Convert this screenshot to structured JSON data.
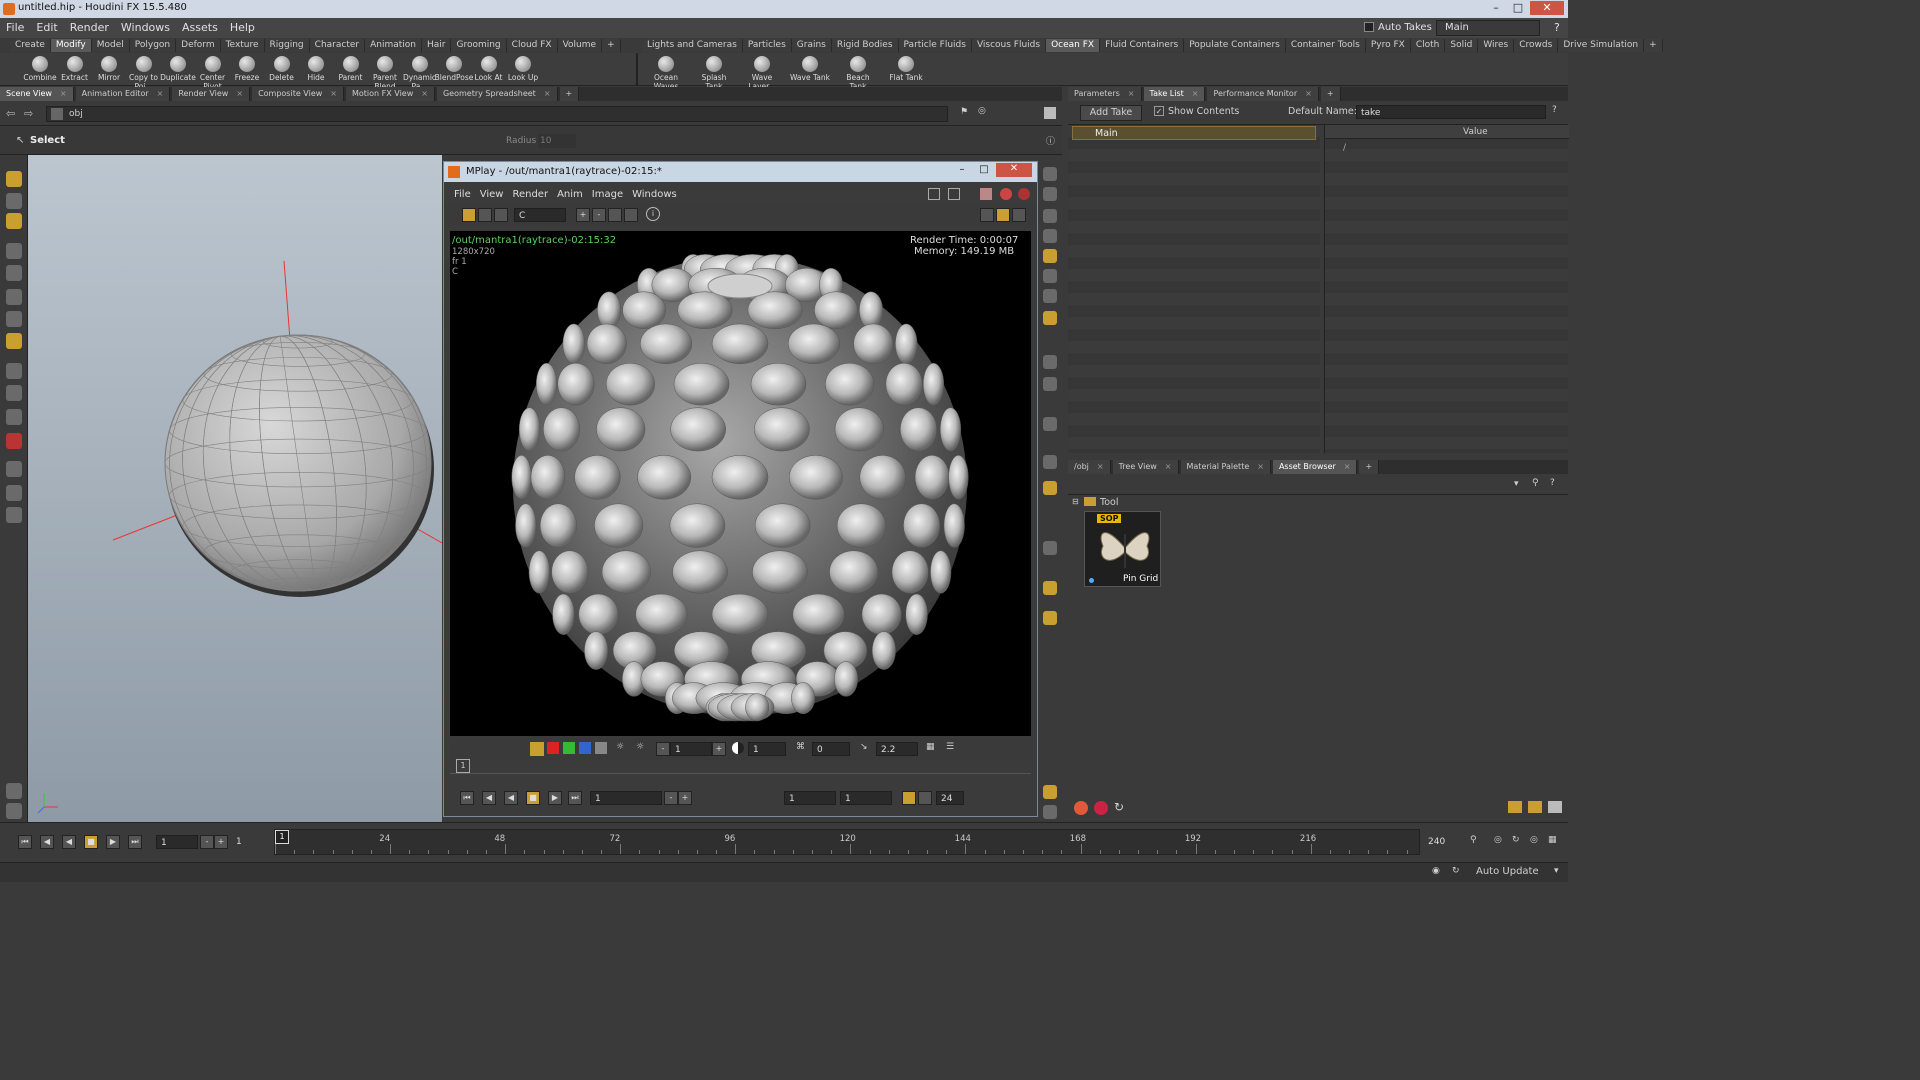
{
  "app": {
    "title": "untitled.hip - Houdini FX 15.5.480",
    "menu": [
      "File",
      "Edit",
      "Render",
      "Windows",
      "Assets",
      "Help"
    ],
    "auto_takes_label": "Auto Takes",
    "desktop": "Main"
  },
  "shelf_left": {
    "tabs": [
      "Create",
      "Modify",
      "Model",
      "Polygon",
      "Deform",
      "Texture",
      "Rigging",
      "Character",
      "Animation",
      "Hair",
      "Grooming",
      "Cloud FX",
      "Volume"
    ],
    "active_tab": "Modify",
    "tools": [
      "Combine",
      "Extract",
      "Mirror",
      "Copy to Poi...",
      "Duplicate",
      "Center Pivot",
      "Freeze",
      "Delete",
      "Hide",
      "Parent",
      "Parent Blend",
      "Dynamic Pa...",
      "BlendPose",
      "Look At",
      "Look Up"
    ]
  },
  "shelf_right": {
    "tabs": [
      "Lights and Cameras",
      "Particles",
      "Grains",
      "Rigid Bodies",
      "Particle Fluids",
      "Viscous Fluids",
      "Ocean FX",
      "Fluid Containers",
      "Populate Containers",
      "Container Tools",
      "Pyro FX",
      "Cloth",
      "Solid",
      "Wires",
      "Crowds",
      "Drive Simulation"
    ],
    "active_tab": "Ocean FX",
    "tools": [
      "Ocean Waves",
      "Splash Tank",
      "Wave Layer...",
      "Wave Tank",
      "Beach Tank",
      "Flat Tank"
    ]
  },
  "pane_tabs": [
    "Scene View",
    "Animation Editor",
    "Render View",
    "Composite View",
    "Motion FX View",
    "Geometry Spreadsheet"
  ],
  "path": "obj",
  "select_label": "Select",
  "radius_label": "Radius",
  "radius_value": "10",
  "mplay": {
    "title": "MPlay - /out/mantra1(raytrace)-02:15:*",
    "menu": [
      "File",
      "View",
      "Render",
      "Anim",
      "Image",
      "Windows"
    ],
    "channel": "C",
    "info_path": "/out/mantra1(raytrace)-02:15:32",
    "info_res": "1280x720",
    "info_frame": "fr 1",
    "info_chan": "C",
    "render_time": "Render Time: 0:00:07",
    "memory": "Memory:   149.19 MB",
    "ctrl_val1": "1",
    "ctrl_val2": "1",
    "ctrl_val3": "0",
    "gamma": "2.2",
    "frame_tab": "1",
    "play_frame": "1",
    "range_start": "1",
    "range_end": "1",
    "fps": "24"
  },
  "params_tabs": [
    "Parameters",
    "Take List",
    "Performance Monitor"
  ],
  "take": {
    "add_take": "Add Take",
    "show_contents": "Show Contents",
    "default_name_label": "Default Name:",
    "default_name": "take",
    "main_take": "Main",
    "value_header": "Value",
    "root": "/"
  },
  "asset_tabs": [
    "/obj",
    "Tree View",
    "Material Palette",
    "Asset Browser"
  ],
  "asset": {
    "folder": "Tool",
    "badge": "SOP",
    "item": "Pin Grid"
  },
  "timeline": {
    "current": "1",
    "start": "1",
    "end": "240",
    "ticks": [
      "24",
      "48",
      "72",
      "96",
      "120",
      "144",
      "168",
      "192",
      "216"
    ]
  },
  "status": {
    "auto_update": "Auto Update"
  }
}
